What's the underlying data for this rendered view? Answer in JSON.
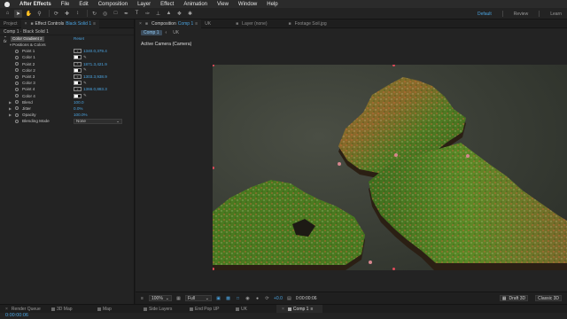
{
  "menubar": {
    "app_name": "After Effects",
    "items": [
      "File",
      "Edit",
      "Composition",
      "Layer",
      "Effect",
      "Animation",
      "View",
      "Window",
      "Help"
    ]
  },
  "toolbar": {
    "tools": [
      "home",
      "arrow",
      "hand",
      "zoom",
      "orbit",
      "move",
      "rotate",
      "undo",
      "camera",
      "rectangle",
      "pen",
      "text",
      "brush",
      "clone",
      "eraser",
      "roto",
      "pin"
    ],
    "workspaces": [
      "Default",
      "Review",
      "Learn"
    ],
    "active_workspace": "Default"
  },
  "effect_controls": {
    "project_tab": "Project",
    "tab_label": "Effect Controls",
    "tab_layer": "Black Solid 1",
    "title": "Comp 1 · Black Solid 1",
    "effect_name": "Color Gradient 2",
    "reset_label": "Reset",
    "group_label": "Positions & Colors",
    "points": [
      {
        "label": "Point 1",
        "value": "1340.0,379.4"
      },
      {
        "label": "Color 1"
      },
      {
        "label": "Point 2",
        "value": "1871.3,421.9"
      },
      {
        "label": "Color 2"
      },
      {
        "label": "Point 3",
        "value": "1303.3,938.9"
      },
      {
        "label": "Color 3"
      },
      {
        "label": "Point 4",
        "value": "1366.0,883.3"
      },
      {
        "label": "Color 4"
      }
    ],
    "blend": {
      "label": "Blend",
      "value": "100.0"
    },
    "jitter": {
      "label": "Jitter",
      "value": "0.0%"
    },
    "opacity": {
      "label": "Opacity",
      "value": "100.0%"
    },
    "blending_mode": {
      "label": "Blending Mode",
      "value": "None"
    }
  },
  "composition": {
    "tab_prefix": "Composition",
    "tab_name": "Comp 1",
    "tab_uk": "UK",
    "layer_tab": "Layer (none)",
    "footage_tab": "Footage Soil.jpg",
    "flow": [
      "Comp 1",
      "UK"
    ],
    "camera_label": "Active Camera (Camera)",
    "bottom": {
      "zoom": "100%",
      "resolution": "Full",
      "exposure": "+0.0",
      "timecode": "0:00:00:06",
      "renderer": "Draft 3D",
      "mode": "Classic 3D"
    }
  },
  "timeline_tabs": [
    "Render Queue",
    "3D Map",
    "Map",
    "Side Layers",
    "End Pop UP",
    "UK",
    "Comp 1"
  ],
  "active_timeline_tab": "Comp 1",
  "timeline_time": "0:00:00:06",
  "colors": {
    "accent": "#4aa3e0",
    "panel": "#232323",
    "handle": "#e04a5a"
  }
}
